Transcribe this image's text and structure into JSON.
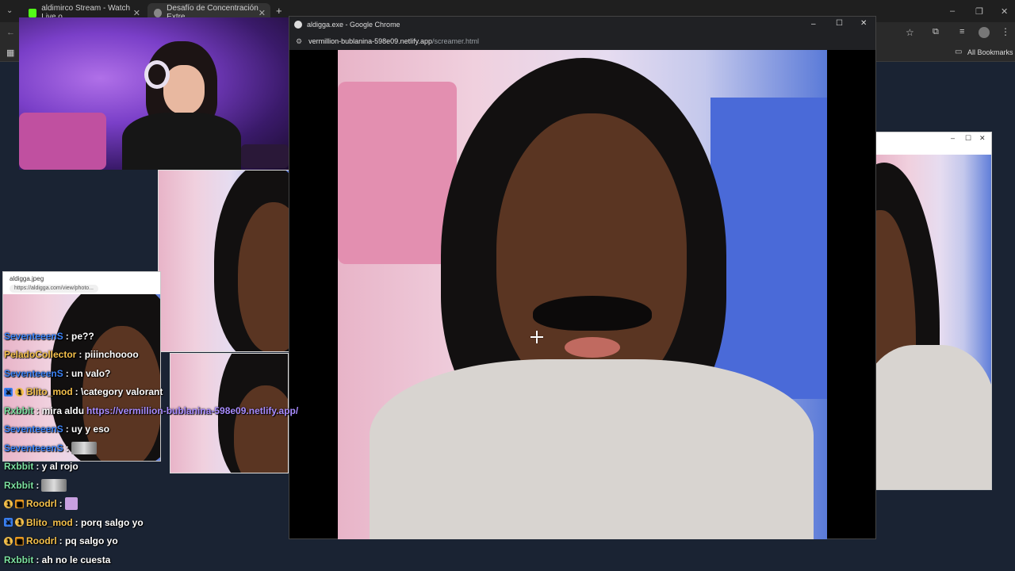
{
  "background_browser": {
    "tabs": [
      {
        "label": "aldimirco Stream - Watch Live o",
        "favicon_color": "#53fc18"
      },
      {
        "label": "Desafío de Concentración Extre",
        "favicon_color": "#888888"
      }
    ],
    "new_tab_label": "+",
    "bookmarks_label": "All Bookmarks"
  },
  "main_window": {
    "title": "aldigga.exe - Google Chrome",
    "url_host": "vermillion-bublanina-598e09.netlify.app",
    "url_path": "/screamer.html",
    "controls": {
      "minimize": "–",
      "maximize": "☐",
      "close": "✕"
    }
  },
  "small_popup": {
    "title": "aldigga.jpeg",
    "url": "https://aldigga.com/view/photo..."
  },
  "chat": [
    {
      "user": "SeventeeenS",
      "color": "#3b82f6",
      "message": ": pe??",
      "badges": []
    },
    {
      "user": "PeladoCollector",
      "color": "#f4c04b",
      "message": ": piiinchoooo",
      "badges": []
    },
    {
      "user": "SeventeeenS",
      "color": "#3b82f6",
      "message": ": un valo?",
      "badges": []
    },
    {
      "user": "Blito_mod",
      "color": "#f4c04b",
      "message": ": \\category valorant",
      "badges": [
        "mod",
        "sub"
      ]
    },
    {
      "user": "Rxbbit",
      "color": "#7be0a0",
      "message": ": mira aldu",
      "link": "https://vermillion-bublanina-598e09.netlify.app/",
      "badges": []
    },
    {
      "user": "SeventeeenS",
      "color": "#3b82f6",
      "message": ": uy y eso",
      "badges": []
    },
    {
      "user": "SeventeeenS",
      "color": "#3b82f6",
      "message": ":",
      "emote": true,
      "badges": []
    },
    {
      "user": "Rxbbit",
      "color": "#7be0a0",
      "message": ": y al rojo",
      "badges": []
    },
    {
      "user": "Rxbbit",
      "color": "#7be0a0",
      "message": ":",
      "emote": true,
      "badges": []
    },
    {
      "user": "Roodrl",
      "color": "#f4c04b",
      "message": ":",
      "emote": true,
      "badges": [
        "sub",
        "gift"
      ]
    },
    {
      "user": "Blito_mod",
      "color": "#f4c04b",
      "message": ": porq salgo yo",
      "badges": [
        "mod",
        "sub"
      ]
    },
    {
      "user": "Roodrl",
      "color": "#f4c04b",
      "message": ": pq salgo yo",
      "badges": [
        "sub",
        "gift"
      ]
    },
    {
      "user": "Rxbbit",
      "color": "#7be0a0",
      "message": ": ah no le cuesta",
      "badges": []
    }
  ]
}
